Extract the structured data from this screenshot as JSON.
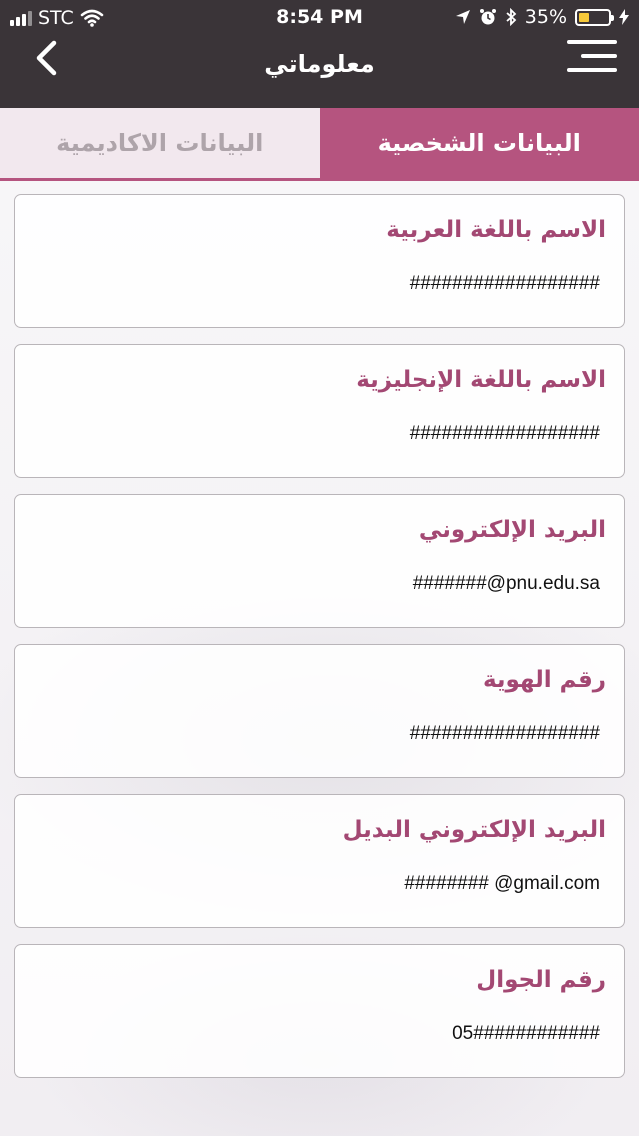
{
  "status_bar": {
    "carrier": "STC",
    "time": "8:54 PM",
    "battery_percent": "35%",
    "battery_level": 0.35
  },
  "header": {
    "title": "معلوماتي",
    "icons": {
      "back": "chevron-left-icon",
      "menu": "hamburger-menu-icon"
    }
  },
  "tabs": [
    {
      "label": "البيانات الاكاديمية",
      "active": false
    },
    {
      "label": "البيانات الشخصية",
      "active": true
    }
  ],
  "fields": [
    {
      "label": "الاسم باللغة العربية",
      "value": "##################"
    },
    {
      "label": "الاسم باللغة الإنجليزية",
      "value": "##################"
    },
    {
      "label": "البريد الإلكتروني",
      "value": "#######@pnu.edu.sa"
    },
    {
      "label": "رقم الهوية",
      "value": "##################"
    },
    {
      "label": "البريد الإلكتروني البديل",
      "value": "######## @gmail.com"
    },
    {
      "label": "رقم الجوال",
      "value": "05############"
    }
  ],
  "colors": {
    "header_bg": "#3a3438",
    "accent": "#b5547f",
    "label_color": "#a34873",
    "inactive_tab_bg": "#f2e8ee",
    "battery_fill": "#f6c93a"
  }
}
